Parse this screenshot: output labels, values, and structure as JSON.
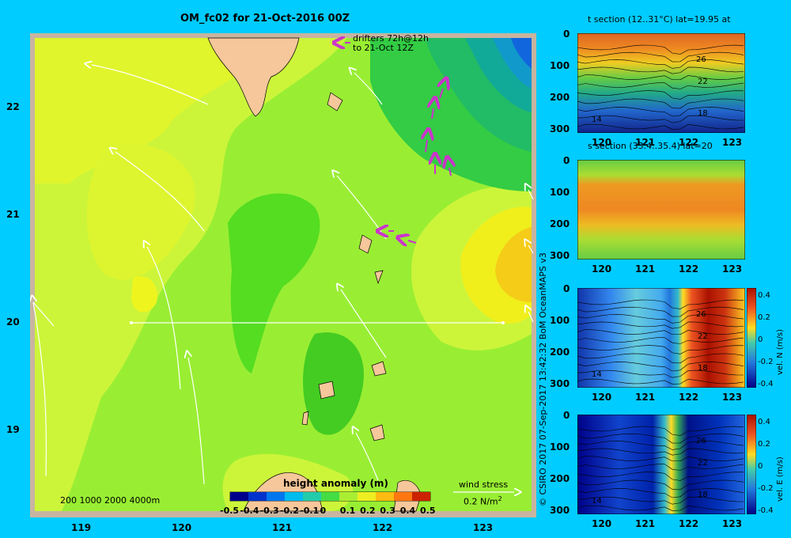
{
  "main_map": {
    "title": "OM_fc02 for 21-Oct-2016 00Z",
    "drifters_line1": "drifters 72h@12h",
    "drifters_line2": "to 21-Oct 12Z",
    "depth_legend": "200  1000  2000  4000m",
    "colorbar_title": "height anomaly (m)",
    "colorbar_ticks": [
      "-0.5",
      "-0.4",
      "-0.3",
      "-0.2",
      "-0.1",
      "0",
      "0.1",
      "0.2",
      "0.3",
      "0.4",
      "0.5"
    ],
    "wind_label": "wind stress",
    "wind_unit": "0.2 N/m",
    "wind_unit_sup": "2",
    "x_ticks": [
      "119",
      "120",
      "121",
      "122",
      "123"
    ],
    "y_ticks": [
      "22",
      "21",
      "20",
      "19"
    ]
  },
  "credit": "© CSIRO 2017   07-Sep-2017 13:42:32 BoM OceanMAPS v3",
  "panels": [
    {
      "title": "t section (12..31°C) lat=19.95 at",
      "y_ticks": [
        "0",
        "100",
        "200",
        "300"
      ],
      "x_ticks": [
        "120",
        "121",
        "122",
        "123"
      ],
      "contour_labels": [
        "26",
        "22",
        "18",
        "14"
      ]
    },
    {
      "title": "s section (33.4..35.4) lat=20",
      "y_ticks": [
        "0",
        "100",
        "200",
        "300"
      ],
      "x_ticks": [
        "120",
        "121",
        "122",
        "123"
      ]
    },
    {
      "title": "",
      "y_ticks": [
        "0",
        "100",
        "200",
        "300"
      ],
      "x_ticks": [
        "120",
        "121",
        "122",
        "123"
      ],
      "contour_labels": [
        "26",
        "22",
        "18",
        "14"
      ],
      "cbar_label": "vel. N (m/s)",
      "cbar_ticks": [
        "0.4",
        "0.2",
        "0",
        "-0.2",
        "-0.4"
      ]
    },
    {
      "title": "",
      "y_ticks": [
        "0",
        "100",
        "200",
        "300"
      ],
      "x_ticks": [
        "120",
        "121",
        "122",
        "123"
      ],
      "contour_labels": [
        "26",
        "22",
        "18",
        "14"
      ],
      "cbar_label": "vel. E (m/s)",
      "cbar_ticks": [
        "0.4",
        "0.2",
        "0",
        "-0.2",
        "-0.4"
      ]
    }
  ],
  "colors": {
    "background": "#00ccff",
    "land": "#f5c79a",
    "shallow": "#c8b4a0",
    "arrow": "#ffffff",
    "drifter": "#cc33cc"
  }
}
